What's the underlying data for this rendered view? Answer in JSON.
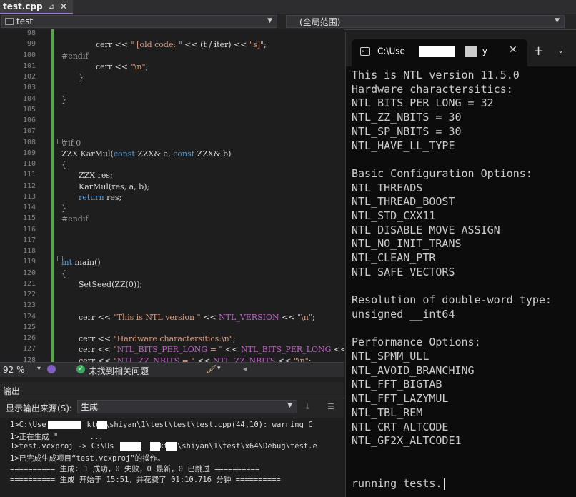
{
  "editor_tab": {
    "title": "test.cpp",
    "pin_glyph": "⊿",
    "close_glyph": "✕"
  },
  "nav": {
    "project": "test",
    "scope": "(全局范围)"
  },
  "code": [
    {
      "n": "98",
      "html": ""
    },
    {
      "n": "99",
      "text": "cerr << \" [old code: \" << (t / iter) << \"s]\";"
    },
    {
      "n": "100",
      "text": "#endif"
    },
    {
      "n": "101",
      "text": "cerr << \"\\n\";"
    },
    {
      "n": "102",
      "text": "}"
    },
    {
      "n": "103",
      "text": ""
    },
    {
      "n": "104",
      "text": "}"
    },
    {
      "n": "105",
      "text": ""
    },
    {
      "n": "106",
      "text": ""
    },
    {
      "n": "107",
      "text": ""
    },
    {
      "n": "108",
      "text": "#if 0"
    },
    {
      "n": "109",
      "text": "ZZX KarMul(const ZZX& a, const ZZX& b)"
    },
    {
      "n": "110",
      "text": "{"
    },
    {
      "n": "111",
      "text": "ZZX res;"
    },
    {
      "n": "112",
      "text": "KarMul(res, a, b);"
    },
    {
      "n": "113",
      "text": "return res;"
    },
    {
      "n": "114",
      "text": "}"
    },
    {
      "n": "115",
      "text": "#endif"
    },
    {
      "n": "116",
      "text": ""
    },
    {
      "n": "117",
      "text": ""
    },
    {
      "n": "118",
      "text": ""
    },
    {
      "n": "119",
      "text": "int main()"
    },
    {
      "n": "120",
      "text": "{"
    },
    {
      "n": "121",
      "text": "SetSeed(ZZ(0));"
    },
    {
      "n": "122",
      "text": ""
    },
    {
      "n": "123",
      "text": ""
    },
    {
      "n": "124",
      "text": "cerr << \"This is NTL version \" << NTL_VERSION << \"\\n\";"
    },
    {
      "n": "125",
      "text": ""
    },
    {
      "n": "126",
      "text": "cerr << \"Hardware charactersitics:\\n\";"
    },
    {
      "n": "127",
      "text": "cerr << \"NTL_BITS_PER_LONG = \" << NTL_BITS_PER_LONG << \"\\n\";"
    },
    {
      "n": "128",
      "text": "cerr << \"NTL_ZZ_NBITS = \" << NTL_ZZ_NBITS << \"\\n\";"
    }
  ],
  "status": {
    "zoom": "92 %",
    "issues": "未找到相关问题"
  },
  "output": {
    "title": "输出",
    "source_label": "显示输出来源(S):",
    "source_value": "生成",
    "lines": [
      "1>C:\\Use         ktop\\shiyan\\1\\test\\test\\test.cpp(44,10): warning C",
      "1>正在生成 \"       ...",
      "1>test.vcxproj -> C:\\Us         sktop\\shiyan\\1\\test\\x64\\Debug\\test.e",
      "1>已完成生成项目“test.vcxproj”的操作。",
      "========== 生成: 1 成功，0 失败，0 最新，0 已跳过 ==========",
      "========== 生成 开始于 15:51，并花费了 01:10.716 分钟 =========="
    ]
  },
  "terminal": {
    "tab_title": "C:\\Use",
    "tab_title_tail": "y",
    "new_tab": "+",
    "dropdown": "⌄",
    "close": "✕",
    "icon_glyph": ">_",
    "lines": [
      "This is NTL version 11.5.0",
      "Hardware charactersitics:",
      "NTL_BITS_PER_LONG = 32",
      "NTL_ZZ_NBITS = 30",
      "NTL_SP_NBITS = 30",
      "NTL_HAVE_LL_TYPE",
      "",
      "Basic Configuration Options:",
      "NTL_THREADS",
      "NTL_THREAD_BOOST",
      "NTL_STD_CXX11",
      "NTL_DISABLE_MOVE_ASSIGN",
      "NTL_NO_INIT_TRANS",
      "NTL_CLEAN_PTR",
      "NTL_SAFE_VECTORS",
      "",
      "Resolution of double-word type:",
      "unsigned __int64",
      "",
      "Performance Options:",
      "NTL_SPMM_ULL",
      "NTL_AVOID_BRANCHING",
      "NTL_FFT_BIGTAB",
      "NTL_FFT_LAZYMUL",
      "NTL_TBL_REM",
      "NTL_CRT_ALTCODE",
      "NTL_GF2X_ALTCODE1"
    ],
    "prompt_line": "running tests."
  }
}
